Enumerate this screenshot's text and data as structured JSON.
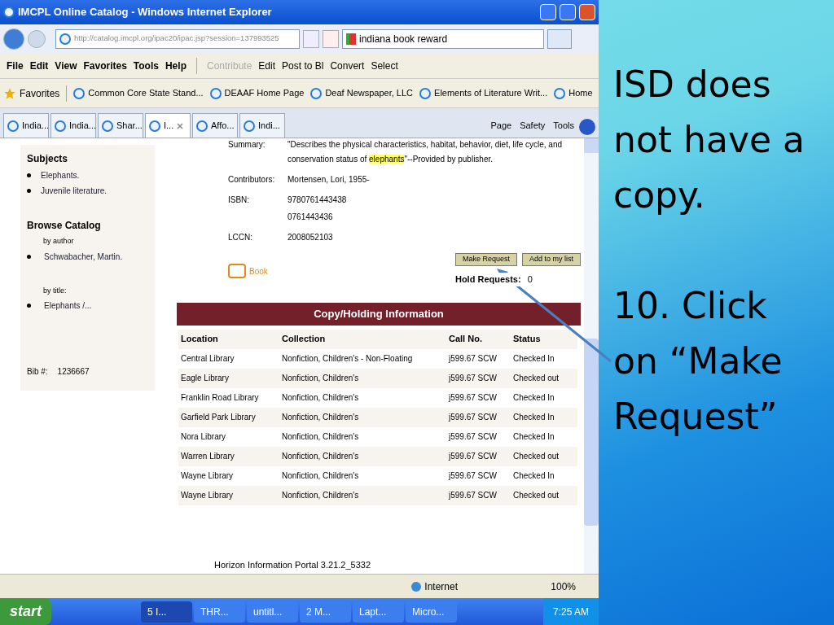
{
  "window": {
    "title": "IMCPL Online Catalog - Windows Internet Explorer"
  },
  "address": {
    "url": "http://catalog.imcpl.org/ipac20/ipac.jsp?session=137993525"
  },
  "search": {
    "value": "indiana book reward"
  },
  "menu": [
    "File",
    "Edit",
    "View",
    "Favorites",
    "Tools",
    "Help"
  ],
  "toolbar": [
    {
      "label": "Contribute",
      "disabled": true
    },
    {
      "label": "Edit",
      "disabled": false
    },
    {
      "label": "Post to Bl",
      "disabled": false
    },
    {
      "label": "Convert",
      "disabled": false
    },
    {
      "label": "Select",
      "disabled": false
    }
  ],
  "favorites": {
    "label": "Favorites",
    "items": [
      "Common Core State Stand...",
      "DEAAF Home Page",
      "Deaf Newspaper, LLC",
      "Elements of Literature Writ...",
      "Home"
    ]
  },
  "tabs": [
    {
      "label": "India...",
      "selected": false
    },
    {
      "label": "India...",
      "selected": false
    },
    {
      "label": "Shar...",
      "selected": false
    },
    {
      "label": "I...",
      "selected": true
    },
    {
      "label": "Affo...",
      "selected": false
    },
    {
      "label": "Indi...",
      "selected": false
    }
  ],
  "command_bar": [
    "Page",
    "Safety",
    "Tools"
  ],
  "sidebar": {
    "subjects_heading": "Subjects",
    "subjects": [
      "Elephants.",
      "Juvenile literature."
    ],
    "browse_heading": "Browse Catalog",
    "by_author": "by author",
    "authors": [
      "Schwabacher, Martin."
    ],
    "by_title": "by title:",
    "titles": [
      "Elephants /..."
    ],
    "bib_label": "Bib #:",
    "bib_value": "1236667"
  },
  "details": {
    "summary_label": "Summary:",
    "summary_line1": "\"Describes the physical characteristics, habitat, behavior, diet, life cycle, and",
    "summary_before": "conservation status of ",
    "summary_highlight": "elephants",
    "summary_after": "\"--Provided by publisher.",
    "rows": [
      {
        "label": "Contributors:",
        "values": [
          "Mortensen, Lori, 1955-"
        ]
      },
      {
        "label": "ISBN:",
        "values": [
          "9780761443438",
          "0761443436"
        ]
      },
      {
        "label": "LCCN:",
        "values": [
          "2008052103"
        ]
      }
    ],
    "format": "Book",
    "buttons": [
      "Make Request",
      "Add to my list"
    ],
    "hold_label": "Hold Requests:",
    "hold_value": "0"
  },
  "holdings": {
    "title": "Copy/Holding Information",
    "columns": [
      "Location",
      "Collection",
      "Call No.",
      "Status"
    ],
    "rows": [
      [
        "Central Library",
        "Nonfiction, Children's - Non-Floating",
        "j599.67 SCW",
        "Checked In"
      ],
      [
        "Eagle Library",
        "Nonfiction, Children's",
        "j599.67 SCW",
        "Checked out"
      ],
      [
        "Franklin Road Library",
        "Nonfiction, Children's",
        "j599.67 SCW",
        "Checked In"
      ],
      [
        "Garfield Park Library",
        "Nonfiction, Children's",
        "j599.67 SCW",
        "Checked In"
      ],
      [
        "Nora Library",
        "Nonfiction, Children's",
        "j599.67 SCW",
        "Checked In"
      ],
      [
        "Warren Library",
        "Nonfiction, Children's",
        "j599.67 SCW",
        "Checked out"
      ],
      [
        "Wayne Library",
        "Nonfiction, Children's",
        "j599.67 SCW",
        "Checked In"
      ],
      [
        "Wayne Library",
        "Nonfiction, Children's",
        "j599.67 SCW",
        "Checked out"
      ]
    ]
  },
  "footer": "Horizon Information Portal 3.21.2_5332",
  "status_bar": {
    "zone": "Internet",
    "zoom": "100%"
  },
  "taskbar": {
    "start": "start",
    "items": [
      {
        "label": "5 I...",
        "selected": true
      },
      {
        "label": "THR...",
        "selected": false
      },
      {
        "label": "untitl...",
        "selected": false
      },
      {
        "label": "2 M...",
        "selected": false
      },
      {
        "label": "Lapt...",
        "selected": false
      },
      {
        "label": "Micro...",
        "selected": false
      }
    ],
    "time": "7:25 AM"
  },
  "slide": {
    "text1": "ISD does not have a copy.",
    "text2": "10. Click on “Make Request”"
  }
}
